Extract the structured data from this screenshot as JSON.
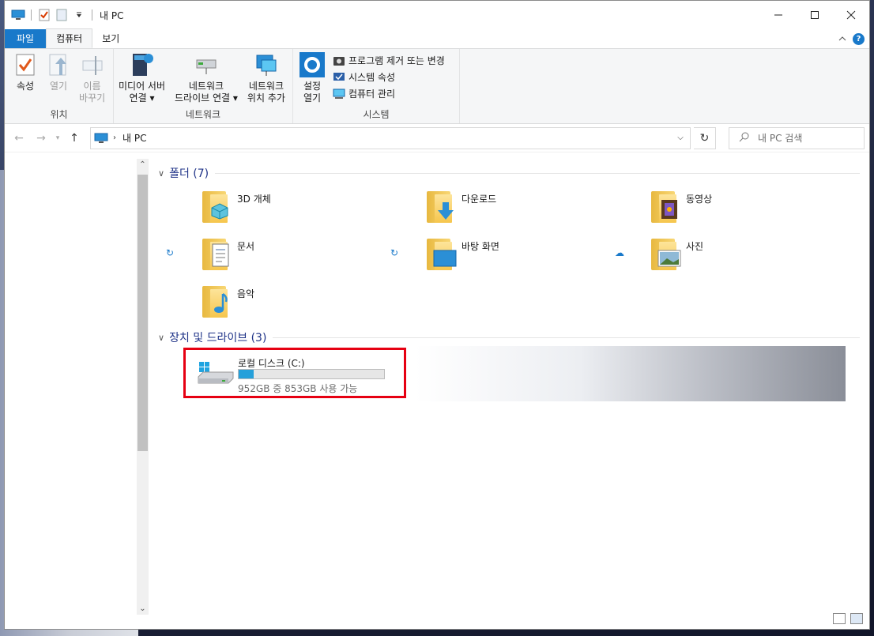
{
  "window": {
    "title": "내 PC",
    "quick_access": [
      "pc-icon",
      "properties-icon",
      "new-folder-icon",
      "customize-dropdown-icon"
    ],
    "controls": {
      "minimize": "—",
      "maximize": "☐",
      "close": "✕"
    }
  },
  "ribbon": {
    "tabs": [
      "파일",
      "컴퓨터",
      "보기"
    ],
    "active_tab": "컴퓨터",
    "help": "?",
    "groups": {
      "location": {
        "label": "위치",
        "buttons": {
          "properties": "속성",
          "open": "열기",
          "rename_line1": "이름",
          "rename_line2": "바꾸기"
        }
      },
      "network": {
        "label": "네트워크",
        "buttons": {
          "media_line1": "미디어 서버",
          "media_line2": "연결",
          "map_line1": "네트워크",
          "map_line2": "드라이브 연결",
          "add_line1": "네트워크",
          "add_line2": "위치 추가"
        }
      },
      "system": {
        "label": "시스템",
        "buttons": {
          "settings_line1": "설정",
          "settings_line2": "열기",
          "uninstall": "프로그램 제거 또는 변경",
          "sys_props": "시스템 속성",
          "manage": "컴퓨터 관리"
        }
      }
    }
  },
  "address": {
    "path": "내 PC",
    "search_placeholder": "내 PC 검색"
  },
  "folders_section": {
    "header": "폴더 (7)",
    "items": [
      {
        "name": "3D 개체"
      },
      {
        "name": "다운로드"
      },
      {
        "name": "동영상"
      },
      {
        "name": "문서"
      },
      {
        "name": "바탕 화면"
      },
      {
        "name": "사진"
      },
      {
        "name": "음악"
      }
    ]
  },
  "devices_section": {
    "header": "장치 및 드라이브 (3)",
    "drive": {
      "name": "로컬 디스크 (C:)",
      "free_text": "952GB 중 853GB 사용 가능",
      "used_fraction": 0.104
    }
  },
  "colors": {
    "accent": "#1979ca",
    "highlight_box": "#e60012",
    "section_header": "#1e3287",
    "bar_fill": "#26a0da"
  }
}
